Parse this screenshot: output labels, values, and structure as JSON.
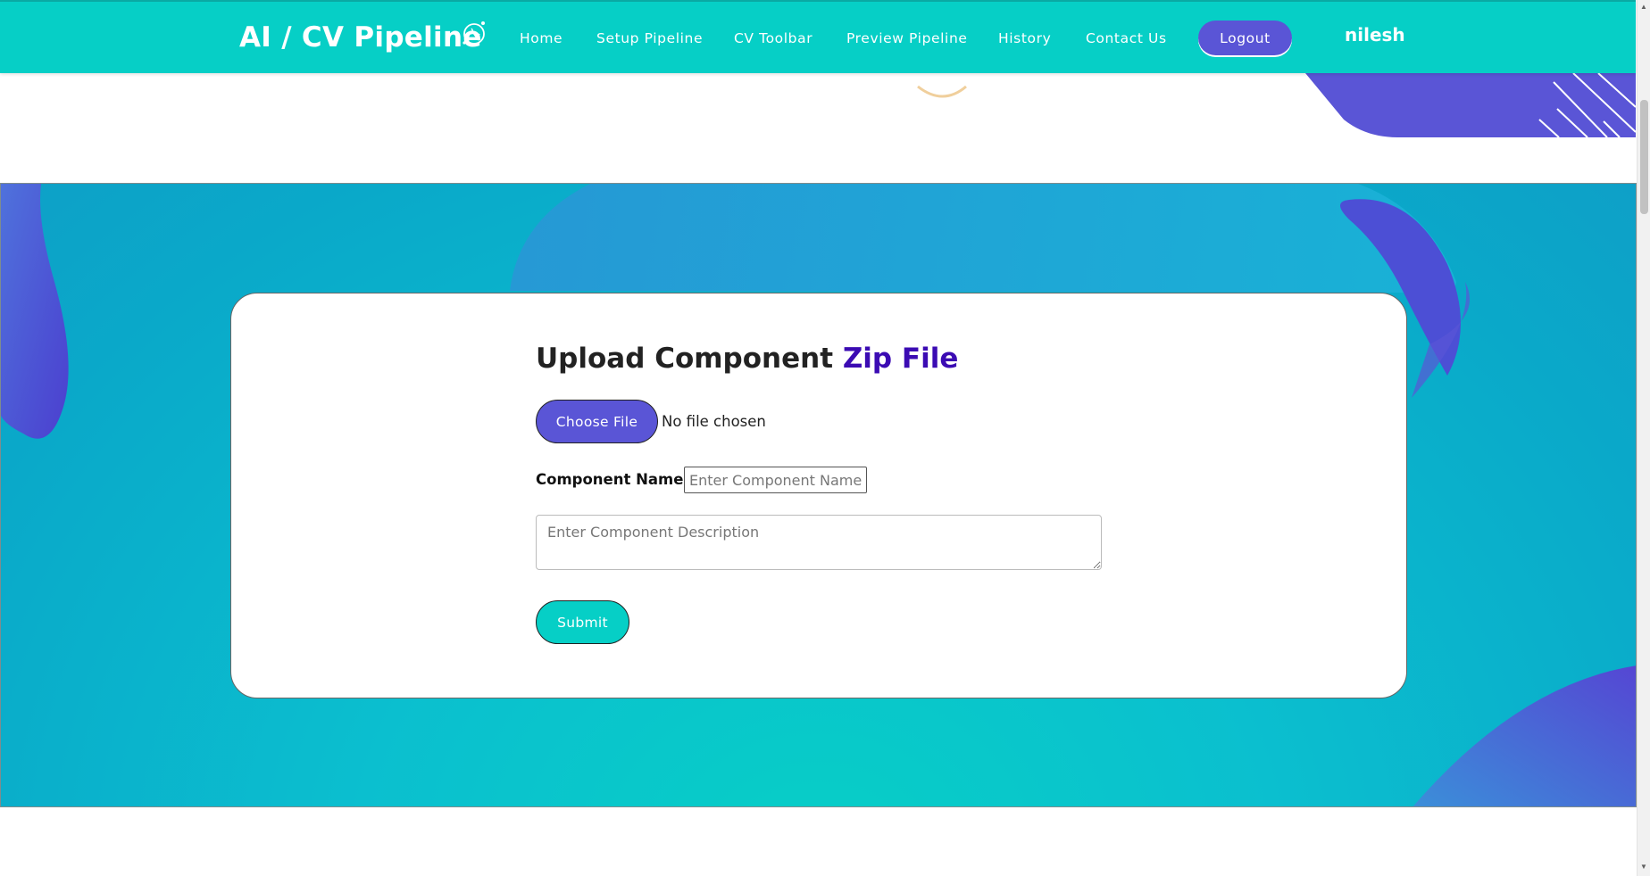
{
  "navbar": {
    "brand": "AI / CV Pipeline",
    "brand_icon": "sparkle-brain-icon",
    "links": [
      "Home",
      "Setup Pipeline",
      "CV Toolbar",
      "Preview Pipeline",
      "History",
      "Contact Us"
    ],
    "logout_label": "Logout",
    "username": "nilesh"
  },
  "form": {
    "title_main": "Upload Component ",
    "title_accent": "Zip File",
    "choose_file_label": "Choose File",
    "file_status": "No file chosen",
    "component_name_label": "Component Name:",
    "component_name_placeholder": "Enter Component Name",
    "component_description_placeholder": "Enter Component Description",
    "submit_label": "Submit"
  },
  "colors": {
    "nav_bg": "#06cfc6",
    "accent_purple": "#5a55d6",
    "title_accent": "#3b0bb3",
    "hero_teal": "#0bbfcf"
  }
}
